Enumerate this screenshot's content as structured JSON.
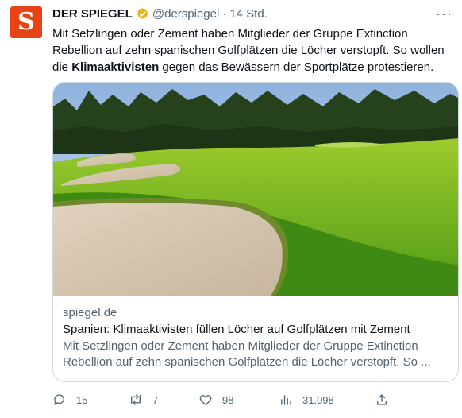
{
  "tweet": {
    "author_name": "DER SPIEGEL",
    "handle": "@derspiegel",
    "separator": "·",
    "time": "14 Std.",
    "text_before": "Mit Setzlingen oder Zement haben Mitglieder der Gruppe Extinction Rebellion auf zehn spanischen Golfplätzen die Löcher verstopft. So wollen die ",
    "text_bold": "Klimaaktivisten",
    "text_after": " gegen das Bewässern der Sportplätze protestieren.",
    "avatar_letter": "S"
  },
  "card": {
    "domain": "spiegel.de",
    "title": "Spanien: Klimaaktivisten füllen Löcher auf Golfplätzen mit Zement",
    "description": "Mit Setzlingen oder Zement haben Mitglieder der Gruppe Extinction Rebellion auf zehn spanischen Golfplätzen die Löcher verstopft. So ..."
  },
  "actions": {
    "replies": "15",
    "retweets": "7",
    "likes": "98",
    "views": "31.098"
  },
  "colors": {
    "brand": "#e64415",
    "verified": "#e2b719",
    "muted": "#536471"
  },
  "icons": [
    "verified-badge-icon",
    "more-icon",
    "reply-icon",
    "retweet-icon",
    "like-icon",
    "views-icon",
    "share-icon"
  ]
}
